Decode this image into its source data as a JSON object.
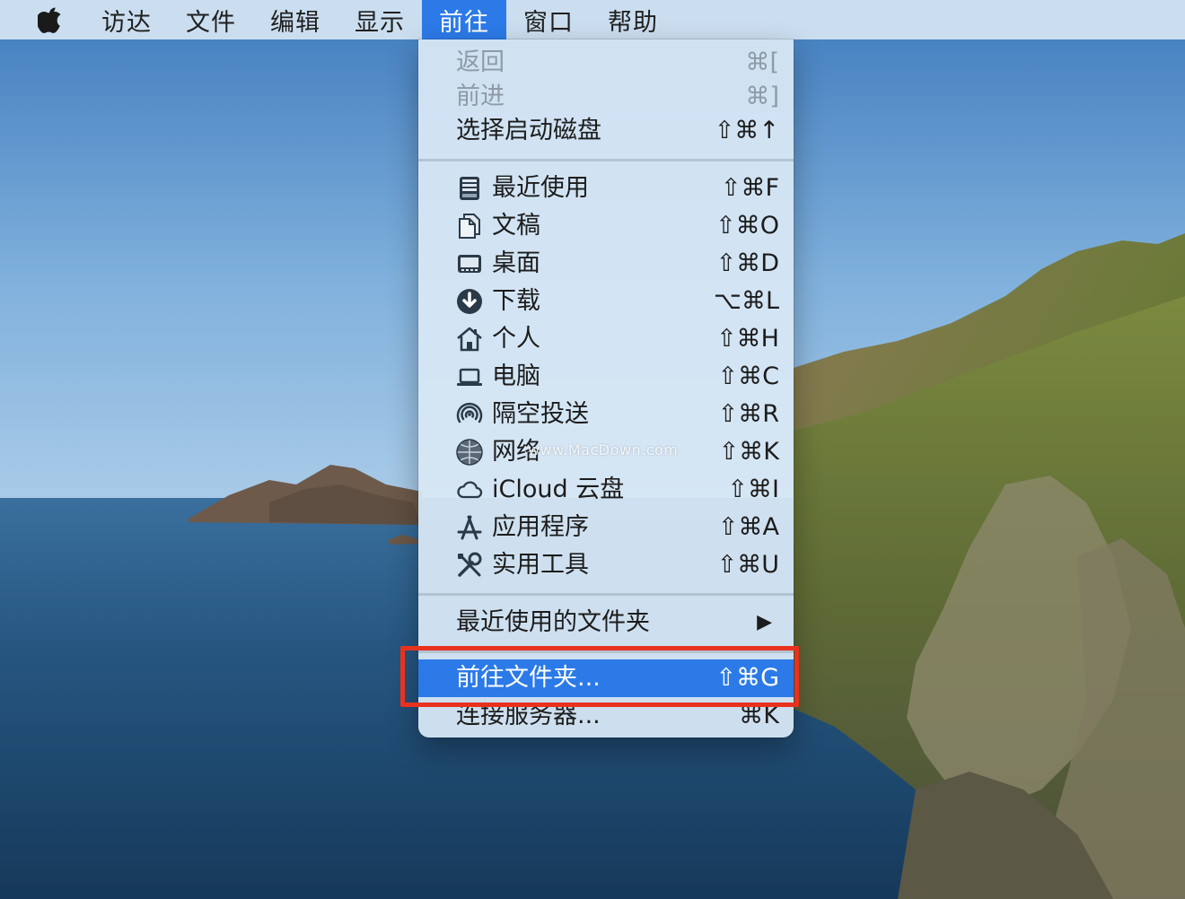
{
  "menubar": {
    "apple_icon": "apple-icon",
    "items": [
      {
        "label": "访达",
        "active": false
      },
      {
        "label": "文件",
        "active": false
      },
      {
        "label": "编辑",
        "active": false
      },
      {
        "label": "显示",
        "active": false
      },
      {
        "label": "前往",
        "active": true
      },
      {
        "label": "窗口",
        "active": false
      },
      {
        "label": "帮助",
        "active": false
      }
    ]
  },
  "menu": {
    "navigation": [
      {
        "label": "返回",
        "shortcut": "⌘[",
        "disabled": true
      },
      {
        "label": "前进",
        "shortcut": "⌘]",
        "disabled": true
      },
      {
        "label": "选择启动磁盘",
        "shortcut": "⇧⌘↑",
        "disabled": false
      }
    ],
    "places": [
      {
        "label": "最近使用",
        "shortcut": "⇧⌘F",
        "icon": "recents-icon"
      },
      {
        "label": "文稿",
        "shortcut": "⇧⌘O",
        "icon": "documents-icon"
      },
      {
        "label": "桌面",
        "shortcut": "⇧⌘D",
        "icon": "desktop-icon"
      },
      {
        "label": "下载",
        "shortcut": "⌥⌘L",
        "icon": "downloads-icon"
      },
      {
        "label": "个人",
        "shortcut": "⇧⌘H",
        "icon": "home-icon"
      },
      {
        "label": "电脑",
        "shortcut": "⇧⌘C",
        "icon": "computer-icon"
      },
      {
        "label": "隔空投送",
        "shortcut": "⇧⌘R",
        "icon": "airdrop-icon"
      },
      {
        "label": "网络",
        "shortcut": "⇧⌘K",
        "icon": "network-icon"
      },
      {
        "label": "iCloud 云盘",
        "shortcut": "⇧⌘I",
        "icon": "icloud-icon"
      },
      {
        "label": "应用程序",
        "shortcut": "⇧⌘A",
        "icon": "applications-icon"
      },
      {
        "label": "实用工具",
        "shortcut": "⇧⌘U",
        "icon": "utilities-icon"
      }
    ],
    "recent_folders": {
      "label": "最近使用的文件夹",
      "arrow": "▶"
    },
    "goto_folder": {
      "label": "前往文件夹...",
      "shortcut": "⇧⌘G",
      "highlighted": true
    },
    "connect_server": {
      "label": "连接服务器...",
      "shortcut": "⌘K"
    }
  },
  "watermark": "www.MacDown.com",
  "colors": {
    "accent": "#2c7ae8",
    "annotation": "#e8321e"
  }
}
